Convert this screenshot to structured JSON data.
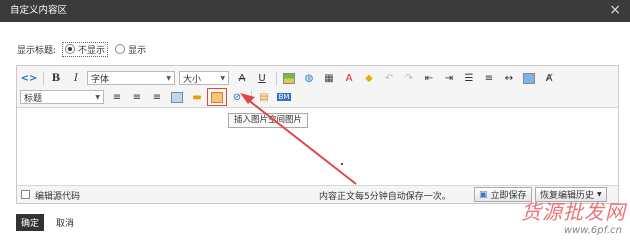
{
  "dialog": {
    "title": "自定义内容区",
    "close_glyph": "×"
  },
  "show_title": {
    "label": "显示标题:",
    "options": [
      "不显示",
      "显示"
    ],
    "selected": "不显示"
  },
  "toolbar": {
    "font_family": "字体",
    "font_size": "大小",
    "paragraph": "标题",
    "tooltip": "插入图片空间图片",
    "bold": "B",
    "italic": "I",
    "strike": "A",
    "underline": "U",
    "emoji_badge": "BM"
  },
  "statusbar": {
    "source_label": "编辑源代码",
    "autosave_text": "内容正文每5分钟自动保存一次。",
    "save_now": "立即保存",
    "history": "恢复编辑历史"
  },
  "footer": {
    "ok": "确定",
    "cancel": "取消"
  },
  "watermark": {
    "line1": "货源批发网",
    "line2": "www.6pf.cn"
  },
  "colors": {
    "titlebar": "#3b3b3b",
    "annotation": "#e04848",
    "ok_button": "#333333"
  }
}
